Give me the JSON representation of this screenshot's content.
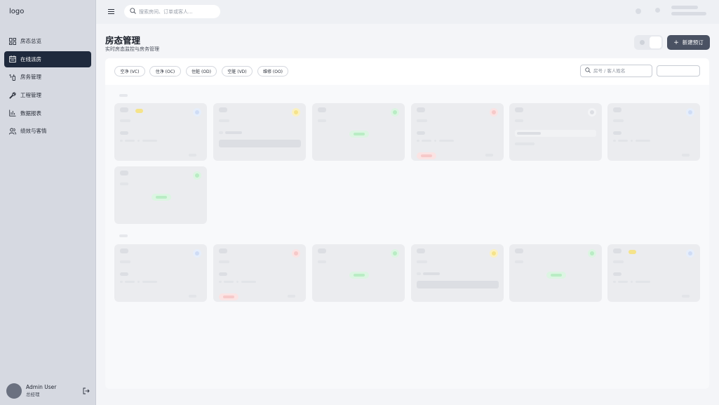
{
  "sidebar": {
    "logo": "logo",
    "items": [
      {
        "label": "房态总览",
        "icon": "dashboard-icon",
        "active": false
      },
      {
        "label": "在线派房",
        "icon": "calendar-icon",
        "active": true
      },
      {
        "label": "房务管理",
        "icon": "cleaning-icon",
        "active": false
      },
      {
        "label": "工程管理",
        "icon": "wrench-icon",
        "active": false
      },
      {
        "label": "数据报表",
        "icon": "bar-chart-icon",
        "active": false
      },
      {
        "label": "绩效与客情",
        "icon": "users-icon",
        "active": false
      }
    ],
    "user": {
      "name": "Admin User",
      "role": "总经理"
    }
  },
  "topbar": {
    "search_placeholder": "搜索房间、订单或客人..."
  },
  "page": {
    "title": "房态管理",
    "subtitle": "实时房态监控与房务管理",
    "new_booking_label": "新建预订"
  },
  "filters": [
    {
      "label": "空净 (VC)"
    },
    {
      "label": "住净 (OC)"
    },
    {
      "label": "住脏 (OD)"
    },
    {
      "label": "空脏 (VD)"
    },
    {
      "label": "维修 (OO)"
    }
  ],
  "room_search_placeholder": "房号 / 客人姓名",
  "colors": {
    "sidebar_bg": "#d6d9e1",
    "active_nav_bg": "#1f2a3d",
    "primary_button": "#4a5263",
    "skeleton": "#ebecef",
    "accent_yellow": "#f5e38a",
    "accent_green": "#b9ecc4",
    "accent_red": "#f6c9c9",
    "accent_blue": "#cfdcf5"
  }
}
